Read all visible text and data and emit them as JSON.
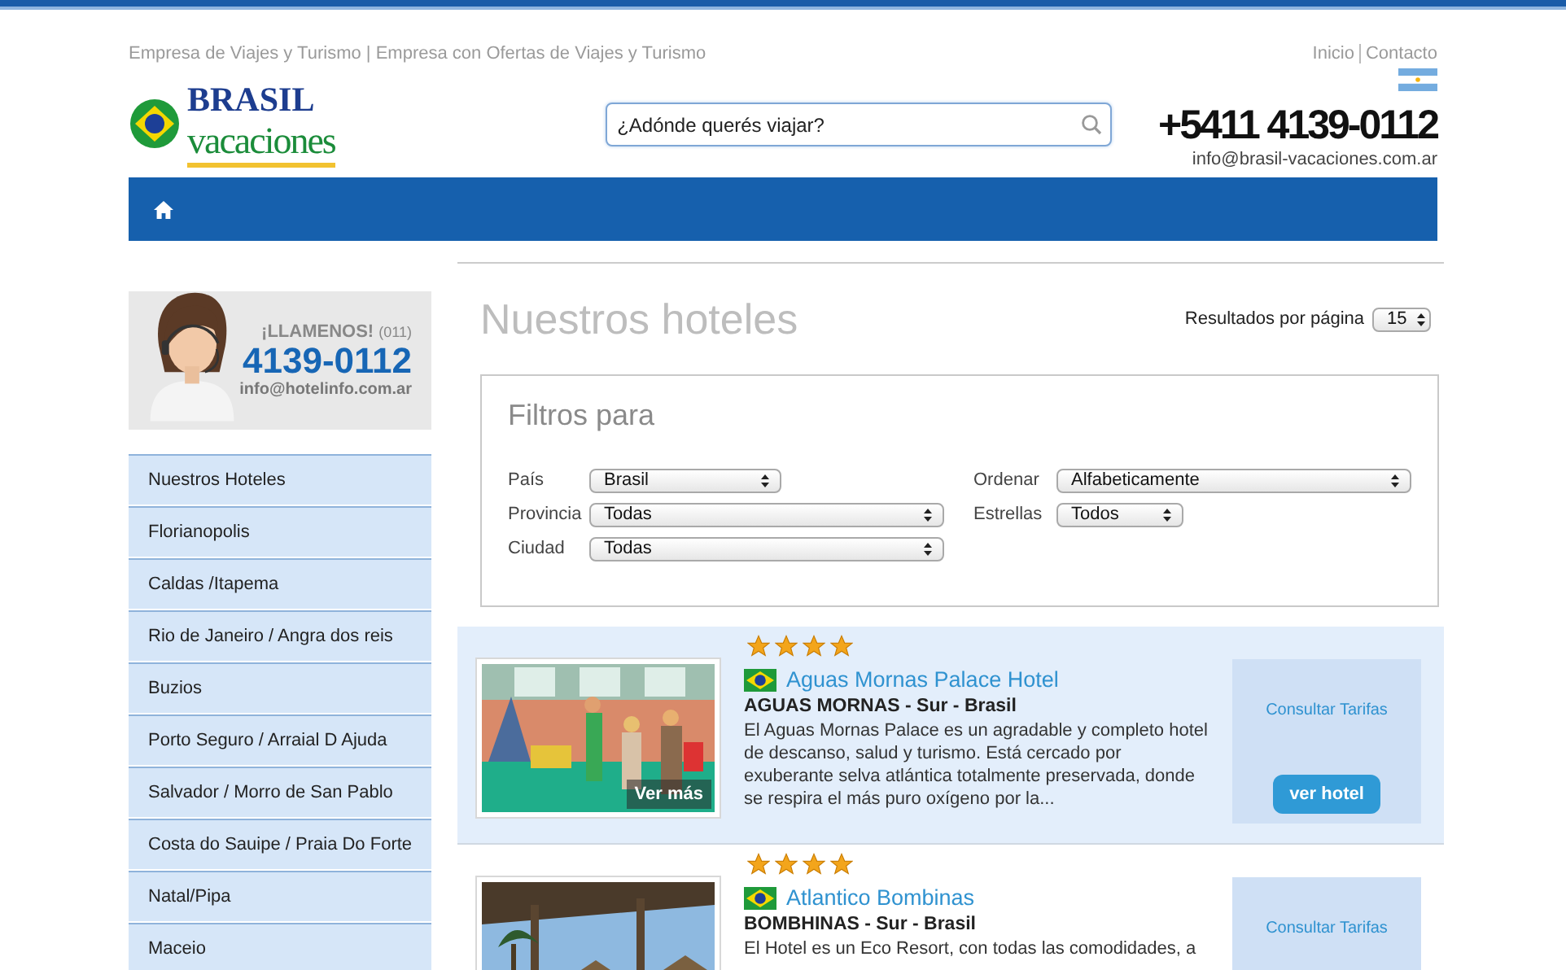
{
  "header": {
    "tagline": "Empresa de Viajes y Turismo | Empresa con Ofertas de Viajes y Turismo",
    "top_links": [
      "Inicio",
      "Contacto"
    ],
    "logo": {
      "line1": "BRASIL",
      "line2": "vacaciones"
    },
    "search": {
      "placeholder": "¿Adónde querés viajar?"
    },
    "phone": "+5411 4139-0112",
    "email": "info@brasil-vacaciones.com.ar"
  },
  "sidebar": {
    "callout": {
      "heading": "¡LLAMENOS!",
      "area_code": "(011)",
      "phone": "4139-0112",
      "email": "info@hotelinfo.com.ar"
    },
    "items": [
      "Nuestros Hoteles",
      "Florianopolis",
      "Caldas /Itapema",
      "Rio de Janeiro / Angra dos reis",
      "Buzios",
      "Porto Seguro / Arraial D Ajuda",
      "Salvador / Morro de San Pablo",
      "Costa do Sauipe / Praia Do Forte",
      "Natal/Pipa",
      "Maceio"
    ]
  },
  "main": {
    "title": "Nuestros hoteles",
    "per_page": {
      "label": "Resultados por página",
      "value": "15"
    },
    "filters": {
      "title": "Filtros para",
      "columns": [
        [
          {
            "label": "País",
            "value": "Brasil"
          },
          {
            "label": "Provincia",
            "value": "Todas"
          },
          {
            "label": "Ciudad",
            "value": "Todas"
          }
        ],
        [
          {
            "label": "Ordenar",
            "value": "Alfabeticamente"
          },
          {
            "label": "Estrellas",
            "value": "Todos"
          }
        ]
      ]
    },
    "hotels": [
      {
        "stars": 4,
        "name": "Aguas Mornas Palace Hotel",
        "location": "AGUAS MORNAS - Sur - Brasil",
        "description": "El Aguas Mornas Palace es un agradable y completo hotel de descanso, salud y turismo. Está cercado por exuberante selva atlántica totalmente preservada, donde se respira el más puro oxígeno por la...",
        "photo_caption": "Ver más",
        "rate_link": "Consultar Tarifas",
        "button": "ver hotel"
      },
      {
        "stars": 4,
        "name": "Atlantico Bombinas",
        "location": "BOMBHINAS - Sur - Brasil",
        "description": "El Hotel es un Eco Resort, con todas las comodidades, a",
        "rate_link": "Consultar Tarifas"
      }
    ]
  }
}
